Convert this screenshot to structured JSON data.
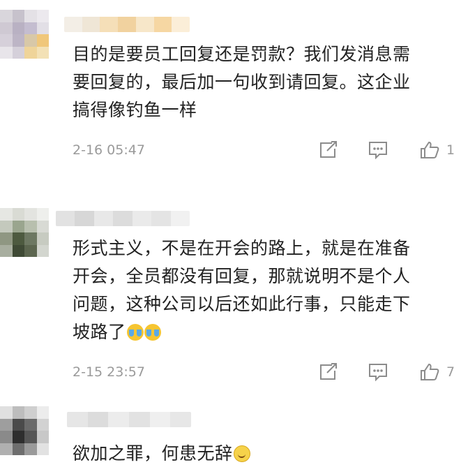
{
  "comments": [
    {
      "text_lines": [
        "目的是要员工回复还是罚款？我们发消息需",
        "要回复的，最后加一句收到请回复。这企业",
        "搞得像钓鱼一样"
      ],
      "time": "2-16 05:47",
      "likes": "1",
      "icons": [
        "share-icon",
        "reply-icon",
        "like-icon"
      ]
    },
    {
      "text_lines": [
        "形式主义，不是在开会的路上，就是在准备",
        "开会，全员都没有回复，那就说明不是个人",
        "问题，这种公司以后还如此行事，只能走下",
        "坡路了"
      ],
      "emoji": [
        "crying-laughing-emoji",
        "crying-laughing-emoji"
      ],
      "time": "2-15 23:57",
      "likes": "7",
      "icons": [
        "share-icon",
        "reply-icon",
        "like-icon"
      ]
    },
    {
      "text_lines": [
        "欲加之罪，何患无辞"
      ],
      "emoji": [
        "smile-emoji"
      ]
    }
  ],
  "colors": {
    "text": "#222222",
    "meta": "#9a9a9a",
    "icon": "#8c8c8c"
  }
}
